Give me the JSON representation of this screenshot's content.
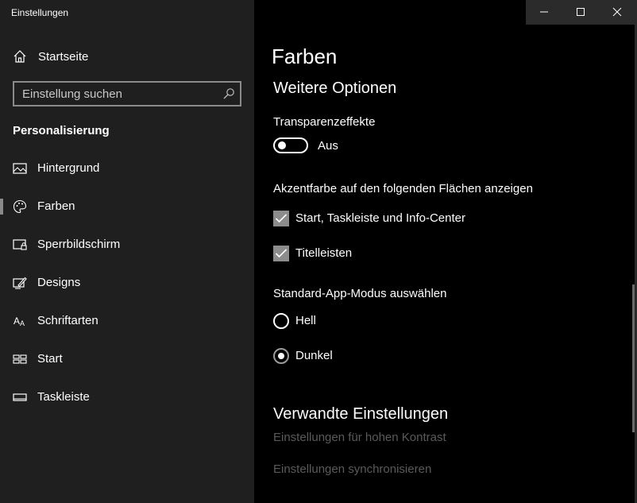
{
  "app_title": "Einstellungen",
  "sidebar": {
    "home_label": "Startseite",
    "search_placeholder": "Einstellung suchen",
    "section_title": "Personalisierung",
    "items": [
      {
        "label": "Hintergrund",
        "icon": "image-icon"
      },
      {
        "label": "Farben",
        "icon": "palette-icon",
        "selected": true
      },
      {
        "label": "Sperrbildschirm",
        "icon": "lock-screen-icon"
      },
      {
        "label": "Designs",
        "icon": "brush-icon"
      },
      {
        "label": "Schriftarten",
        "icon": "font-icon"
      },
      {
        "label": "Start",
        "icon": "start-icon"
      },
      {
        "label": "Taskleiste",
        "icon": "taskbar-icon"
      }
    ]
  },
  "main": {
    "page_title": "Farben",
    "more_options_title": "Weitere Optionen",
    "transparency": {
      "label": "Transparenzeffekte",
      "state_label": "Aus",
      "on": false
    },
    "accent_surfaces": {
      "label": "Akzentfarbe auf den folgenden Flächen anzeigen",
      "options": [
        {
          "label": "Start, Taskleiste und Info-Center",
          "checked": true
        },
        {
          "label": "Titelleisten",
          "checked": true
        }
      ]
    },
    "app_mode": {
      "label": "Standard-App-Modus auswählen",
      "options": [
        {
          "label": "Hell",
          "selected": false
        },
        {
          "label": "Dunkel",
          "selected": true
        }
      ]
    },
    "related": {
      "title": "Verwandte Einstellungen",
      "links": [
        "Einstellungen für hohen Kontrast",
        "Einstellungen synchronisieren"
      ]
    }
  },
  "colors": {
    "sidebar_bg": "#1f1f1f",
    "content_bg": "#000000",
    "checkbox_fill": "#8c8c8c",
    "link_disabled": "#5a5a5a"
  }
}
